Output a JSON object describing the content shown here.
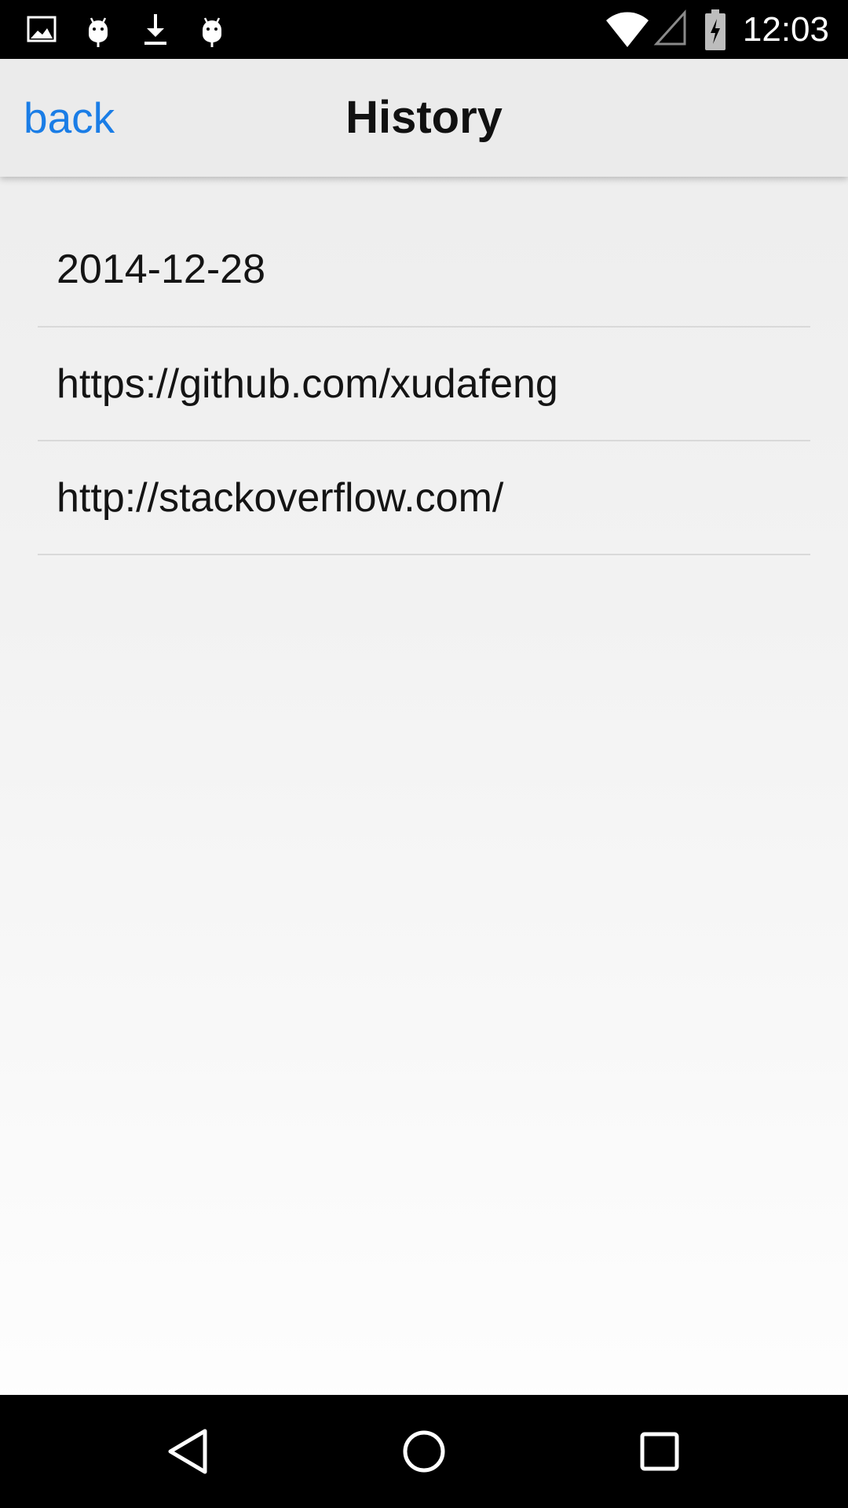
{
  "status_bar": {
    "time": "12:03",
    "left_icons": [
      "image-icon",
      "android-icon",
      "download-icon",
      "android-icon"
    ],
    "right_icons": [
      "wifi-icon",
      "cell-signal-icon",
      "battery-charging-icon"
    ]
  },
  "header": {
    "back_label": "back",
    "title": "History",
    "back_color": "#1a7de6"
  },
  "history": {
    "items": [
      {
        "label": "2014-12-28"
      },
      {
        "label": "https://github.com/xudafeng"
      },
      {
        "label": "http://stackoverflow.com/"
      }
    ]
  },
  "system_nav": {
    "buttons": [
      "back-triangle-icon",
      "home-circle-icon",
      "recents-square-icon"
    ]
  }
}
